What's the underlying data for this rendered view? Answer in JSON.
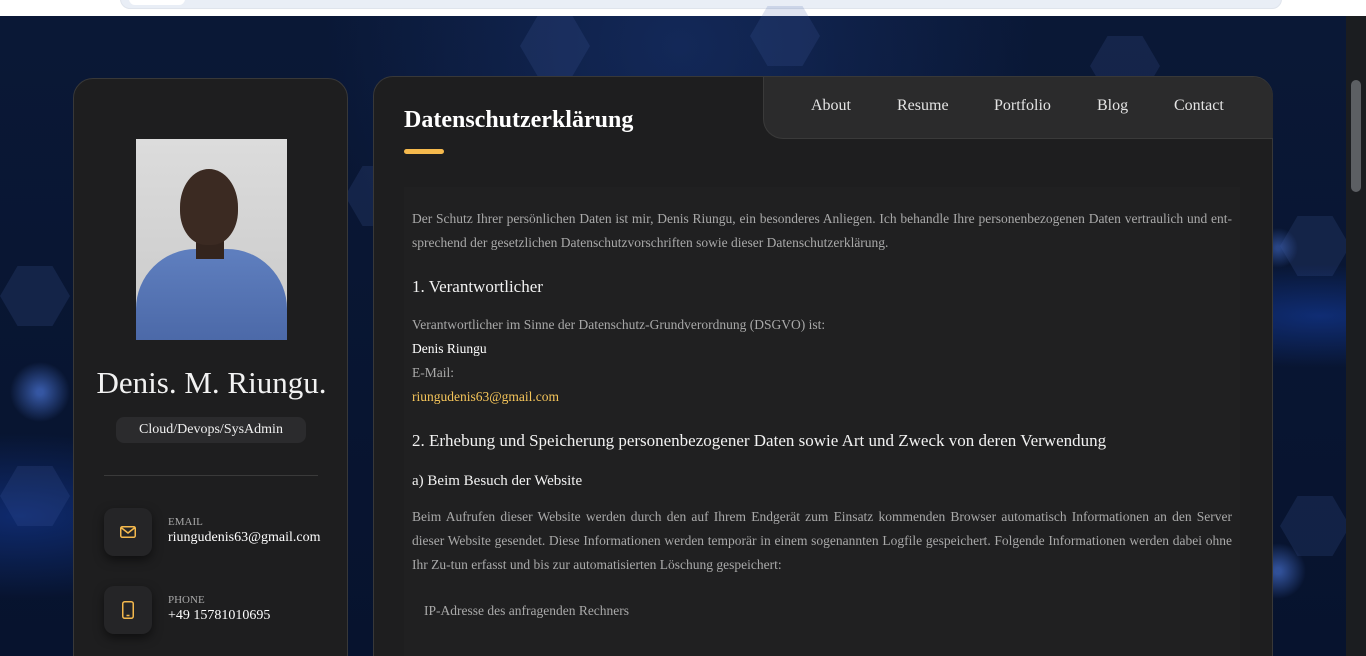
{
  "profile": {
    "name": "Denis. M. Riungu.",
    "role": "Cloud/Devops/SysAdmin",
    "contacts": [
      {
        "label": "EMAIL",
        "value": "riungudenis63@gmail.com",
        "icon": "mail-icon"
      },
      {
        "label": "PHONE",
        "value": "+49 15781010695",
        "icon": "phone-icon"
      }
    ]
  },
  "nav": {
    "items": [
      "About",
      "Resume",
      "Portfolio",
      "Blog",
      "Contact"
    ]
  },
  "page": {
    "title": "Datenschutzerklärung",
    "intro": "Der Schutz Ihrer persönlichen Daten ist mir, Denis Riungu, ein besonderes Anliegen. Ich behandle Ihre personenbezogenen Daten vertraulich und ent-sprechend der gesetzlichen Datenschutzvorschriften sowie dieser Datenschutzerklärung.",
    "section1": {
      "heading": "1. Verantwortlicher",
      "text": "Verantwortlicher im Sinne der Datenschutz-Grundverordnung (DSGVO) ist:",
      "name": "Denis Riungu",
      "email_label": "E-Mail:",
      "email": "riungudenis63@gmail.com"
    },
    "section2": {
      "heading": "2. Erhebung und Speicherung personenbezogener Daten sowie Art und Zweck von deren Verwendung",
      "subheading": "a) Beim Besuch der Website",
      "text": "Beim Aufrufen dieser Website werden durch den auf Ihrem Endgerät zum Einsatz kommenden Browser automatisch Informationen an den Server dieser Website gesendet. Diese Informationen werden temporär in einem sogenannten Logfile gespeichert. Folgende Informationen werden dabei ohne Ihr Zu-tun erfasst und bis zur automatisierten Löschung gespeichert:",
      "list": [
        "IP-Adresse des anfragenden Rechners"
      ]
    }
  },
  "colors": {
    "accent": "#f5b94d",
    "card": "#1e1e1f",
    "background": "#061233"
  }
}
